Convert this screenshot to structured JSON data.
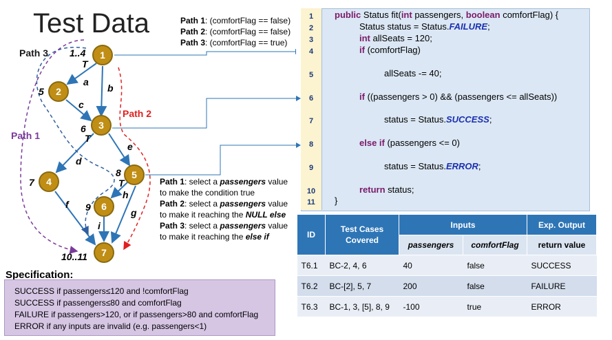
{
  "title": "Test Data",
  "paths_box": [
    {
      "label": "Path 1",
      "text": ": (comfortFlag == false)"
    },
    {
      "label": "Path 2",
      "text": ": (comfortFlag == false)"
    },
    {
      "label": "Path 3",
      "text": ": (comfortFlag == true)"
    }
  ],
  "graph": {
    "nodes": [
      {
        "id": "1",
        "num": "1..4"
      },
      {
        "id": "2",
        "num": "5"
      },
      {
        "id": "3",
        "num": "6"
      },
      {
        "id": "4",
        "num": "7"
      },
      {
        "id": "5",
        "num": "8"
      },
      {
        "id": "6",
        "num": "9"
      },
      {
        "id": "7",
        "num": "10..11"
      }
    ],
    "edge_labels": [
      "a",
      "b",
      "c",
      "d",
      "e",
      "f",
      "g",
      "h",
      "i"
    ],
    "t_labels": [
      "T",
      "T",
      "T"
    ],
    "path_labels": {
      "p1": "Path 1",
      "p2": "Path 2",
      "p3": "Path 3"
    },
    "colors": {
      "node_fill": "#c08e14",
      "node_stroke": "#8a6a10",
      "edge": "#2e75b6",
      "path1": "#7a3a9a",
      "path2": "#e02020",
      "path3": "#2e5f9e"
    }
  },
  "hints": [
    {
      "label": "Path 1",
      "text1": ": select a ",
      "em": "passengers",
      "text2": " value",
      "line2": "to make the condition true"
    },
    {
      "label": "Path 2",
      "text1": ": select a ",
      "em": "passengers",
      "text2": " value",
      "line2a": "to make it reaching the ",
      "line2em": "NULL else"
    },
    {
      "label": "Path 3",
      "text1": ": select a ",
      "em": "passengers",
      "text2": " value",
      "line2a": "to make it reaching the ",
      "line2em": "else if"
    }
  ],
  "code": {
    "line_numbers": [
      "1",
      "2",
      "3",
      "4",
      "5",
      "6",
      "7",
      "8",
      "9",
      "10",
      "11"
    ],
    "l1_kw1": "public",
    "l1_a": " Status fit(",
    "l1_kw2": "int",
    "l1_b": " passengers, ",
    "l1_kw3": "boolean",
    "l1_c": " comfortFlag) {",
    "l2_a": "Status status = Status.",
    "l2_cst": "FAILURE",
    "l2_b": ";",
    "l3_kw": "int",
    "l3_a": " allSeats = 120;",
    "l4_kw": "if",
    "l4_a": " (comfortFlag)",
    "l5": "allSeats -= 40;",
    "l6_kw": "if",
    "l6_a": " ((passengers > 0) && (passengers <= allSeats))",
    "l7_a": "status = Status.",
    "l7_cst": "SUCCESS",
    "l7_b": ";",
    "l8_kw": "else if",
    "l8_a": " (passengers <= 0)",
    "l9_a": "status = Status.",
    "l9_cst": "ERROR",
    "l9_b": ";",
    "l10_kw": "return",
    "l10_a": " status;",
    "l11": "}"
  },
  "specification": {
    "title": "Specification:",
    "lines": [
      "SUCCESS if passengers≤120 and !comfortFlag",
      "SUCCESS if passengers≤80 and comfortFlag",
      "FAILURE if passengers>120, or if passengers>80 and comfortFlag",
      "ERROR if any inputs are invalid (e.g. passengers<1)"
    ]
  },
  "table": {
    "headers": {
      "id": "ID",
      "cases": "Test Cases Covered",
      "inputs": "Inputs",
      "expected": "Exp. Output"
    },
    "subheaders": {
      "passengers": "passengers",
      "comfortFlag": "comfortFlag",
      "return": "return value"
    },
    "rows": [
      {
        "id": "T6.1",
        "cases": "BC-2, 4, 6",
        "passengers": "40",
        "comfortFlag": "false",
        "output": "SUCCESS"
      },
      {
        "id": "T6.2",
        "cases": "BC-[2], 5, 7",
        "passengers": "200",
        "comfortFlag": "false",
        "output": "FAILURE"
      },
      {
        "id": "T6.3",
        "cases": "BC-1, 3, [5], 8, 9",
        "passengers": "-100",
        "comfortFlag": "true",
        "output": "ERROR"
      }
    ]
  }
}
